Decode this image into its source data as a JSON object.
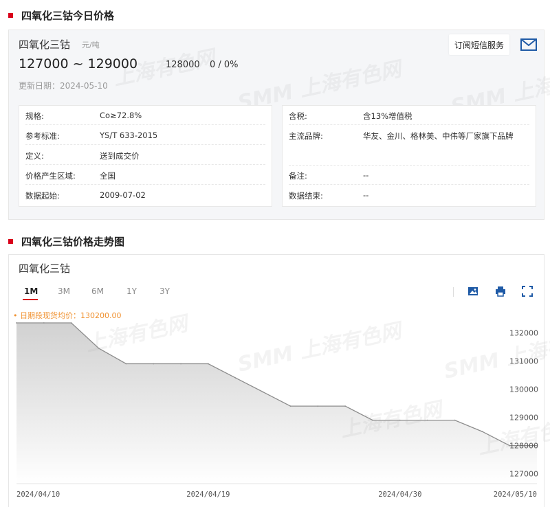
{
  "section1": {
    "title": "四氧化三钴今日价格"
  },
  "price": {
    "name": "四氧化三钴",
    "unit": "元/吨",
    "range": "127000 ~ 129000",
    "avg": "128000",
    "change": "0 / 0%",
    "update_date": "更新日期：2024-05-10",
    "subscribe_label": "订阅短信服务"
  },
  "info_left": [
    {
      "key": "规格:",
      "value": "Co≥72.8%"
    },
    {
      "key": "参考标准:",
      "value": "YS/T 633-2015"
    },
    {
      "key": "定义:",
      "value": "送到成交价"
    },
    {
      "key": "价格产生区域:",
      "value": "全国"
    },
    {
      "key": "数据起始:",
      "value": "2009-07-02"
    }
  ],
  "info_right": [
    {
      "key": "含税:",
      "value": "含13%增值税"
    },
    {
      "key": "主流品牌:",
      "value": "华友、金川、格林美、中伟等厂家旗下品牌"
    },
    {
      "key": "备注:",
      "value": "--"
    },
    {
      "key": "数据结束:",
      "value": "--"
    }
  ],
  "section2": {
    "title": "四氧化三钴价格走势图"
  },
  "chart_panel": {
    "name": "四氧化三钴",
    "tabs": [
      "1M",
      "3M",
      "6M",
      "1Y",
      "3Y"
    ],
    "active_tab": "1M",
    "avg_label": "• 日期段现货均价：130200.00",
    "tools": [
      "image-icon",
      "print-icon",
      "fullscreen-icon"
    ]
  },
  "watermark": {
    "brand": "SMM",
    "text": "上海有色网"
  },
  "colors": {
    "accent": "#d9001b",
    "avg_label": "#f0912f",
    "series_line": "#8c8c8c"
  },
  "chart_data": {
    "type": "area",
    "x": [
      "2024-04-10",
      "2024-04-11",
      "2024-04-12",
      "2024-04-15",
      "2024-04-16",
      "2024-04-17",
      "2024-04-18",
      "2024-04-19",
      "2024-04-22",
      "2024-04-23",
      "2024-04-24",
      "2024-04-25",
      "2024-04-26",
      "2024-04-29",
      "2024-04-30",
      "2024-05-06",
      "2024-05-07",
      "2024-05-08",
      "2024-05-09",
      "2024-05-10"
    ],
    "series": [
      {
        "values": [
          132350,
          132350,
          132350,
          131450,
          130900,
          130900,
          130900,
          130900,
          130400,
          129900,
          129400,
          129400,
          129400,
          128900,
          128900,
          128900,
          128900,
          128500,
          128000,
          128000
        ]
      }
    ],
    "x_tick_labels": [
      "2024/04/10",
      "2024/04/19",
      "2024/04/30",
      "2024/05/10"
    ],
    "x_tick_dates": [
      "2024-04-10",
      "2024-04-19",
      "2024-04-30",
      "2024-05-10"
    ],
    "y_ticks": [
      127000,
      128000,
      129000,
      130000,
      131000,
      132000
    ],
    "ylim": [
      126650,
      132350
    ],
    "xlabel": "",
    "ylabel": "",
    "grid": false
  }
}
